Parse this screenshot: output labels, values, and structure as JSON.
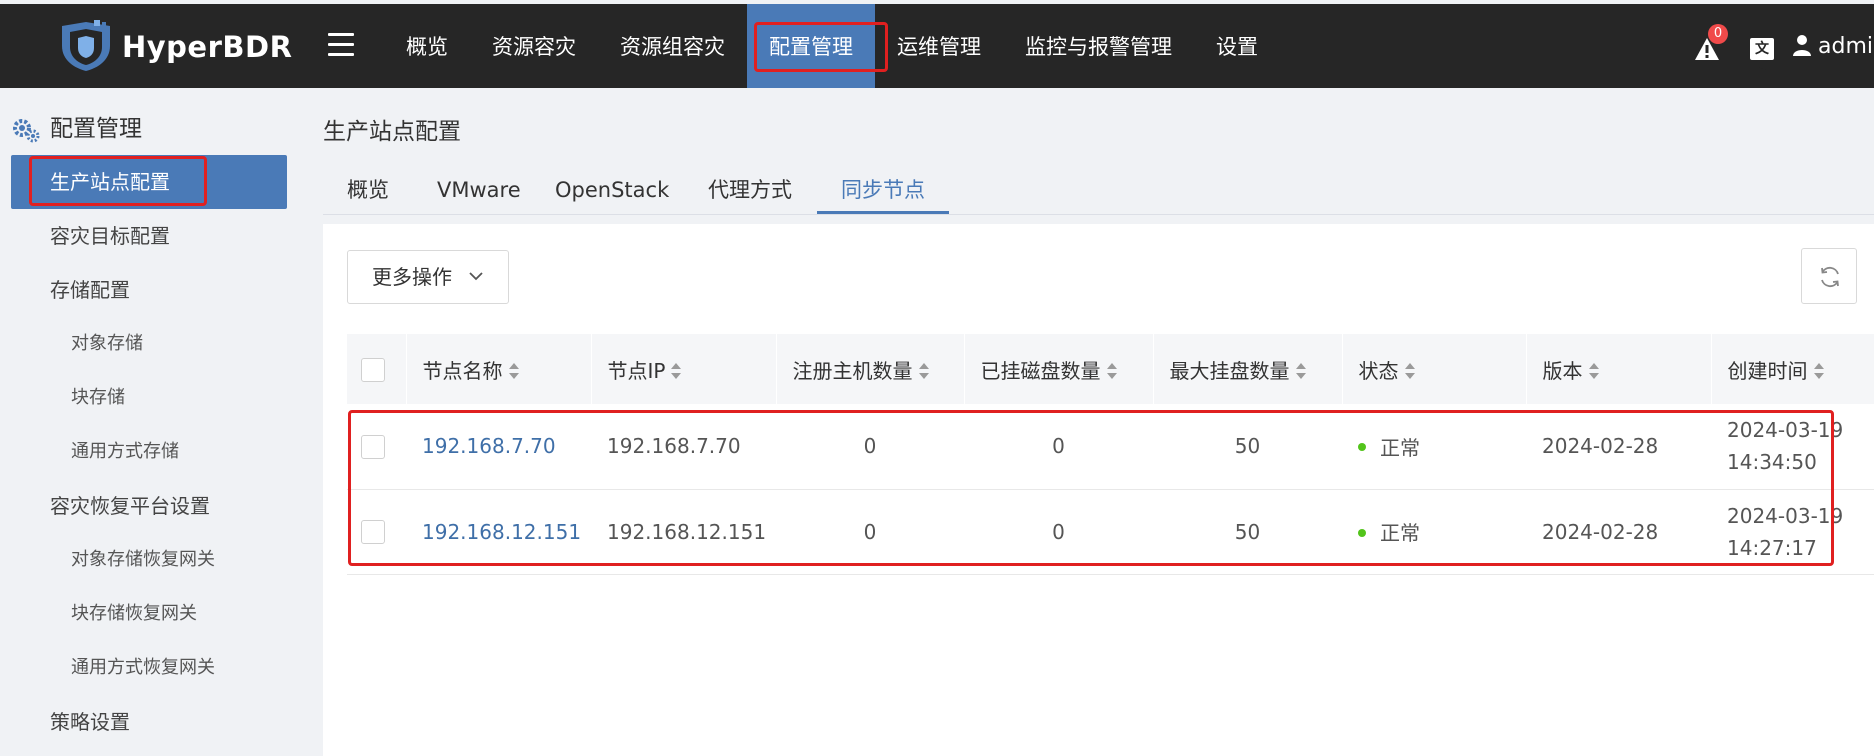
{
  "header": {
    "app_name": "HyperBDR",
    "nav": [
      {
        "label": "概览"
      },
      {
        "label": "资源容灾"
      },
      {
        "label": "资源组容灾"
      },
      {
        "label": "配置管理",
        "active": true
      },
      {
        "label": "运维管理"
      },
      {
        "label": "监控与报警管理"
      },
      {
        "label": "设置"
      }
    ],
    "alert_count": "0",
    "lang_icon": "文A",
    "user": "admin"
  },
  "sidebar": {
    "section_title": "配置管理",
    "items": [
      {
        "label": "生产站点配置",
        "level": 1,
        "active": true
      },
      {
        "label": "容灾目标配置",
        "level": 1
      },
      {
        "label": "存储配置",
        "level": 1
      },
      {
        "label": "对象存储",
        "level": 2
      },
      {
        "label": "块存储",
        "level": 2
      },
      {
        "label": "通用方式存储",
        "level": 2
      },
      {
        "label": "容灾恢复平台设置",
        "level": 1
      },
      {
        "label": "对象存储恢复网关",
        "level": 2
      },
      {
        "label": "块存储恢复网关",
        "level": 2
      },
      {
        "label": "通用方式恢复网关",
        "level": 2
      },
      {
        "label": "策略设置",
        "level": 1
      }
    ]
  },
  "main": {
    "page_title": "生产站点配置",
    "tabs": [
      {
        "label": "概览"
      },
      {
        "label": "VMware"
      },
      {
        "label": "OpenStack"
      },
      {
        "label": "代理方式"
      },
      {
        "label": "同步节点",
        "active": true
      }
    ],
    "more_actions_label": "更多操作",
    "table": {
      "columns": [
        "节点名称",
        "节点IP",
        "注册主机数量",
        "已挂磁盘数量",
        "最大挂盘数量",
        "状态",
        "版本",
        "创建时间"
      ],
      "rows": [
        {
          "name": "192.168.7.70",
          "ip": "192.168.7.70",
          "hosts": "0",
          "disks": "0",
          "max_disks": "50",
          "status": "正常",
          "version": "2024-02-28",
          "created_date": "2024-03-19",
          "created_time": "14:34:50"
        },
        {
          "name": "192.168.12.151",
          "ip": "192.168.12.151",
          "hosts": "0",
          "disks": "0",
          "max_disks": "50",
          "status": "正常",
          "version": "2024-02-28",
          "created_date": "2024-03-19",
          "created_time": "14:27:17"
        }
      ]
    }
  },
  "colors": {
    "topbar": "#262626",
    "accent": "#4a7ab7",
    "highlight_box": "#e02020",
    "status_ok": "#52c41a",
    "link": "#3f6fa8"
  }
}
